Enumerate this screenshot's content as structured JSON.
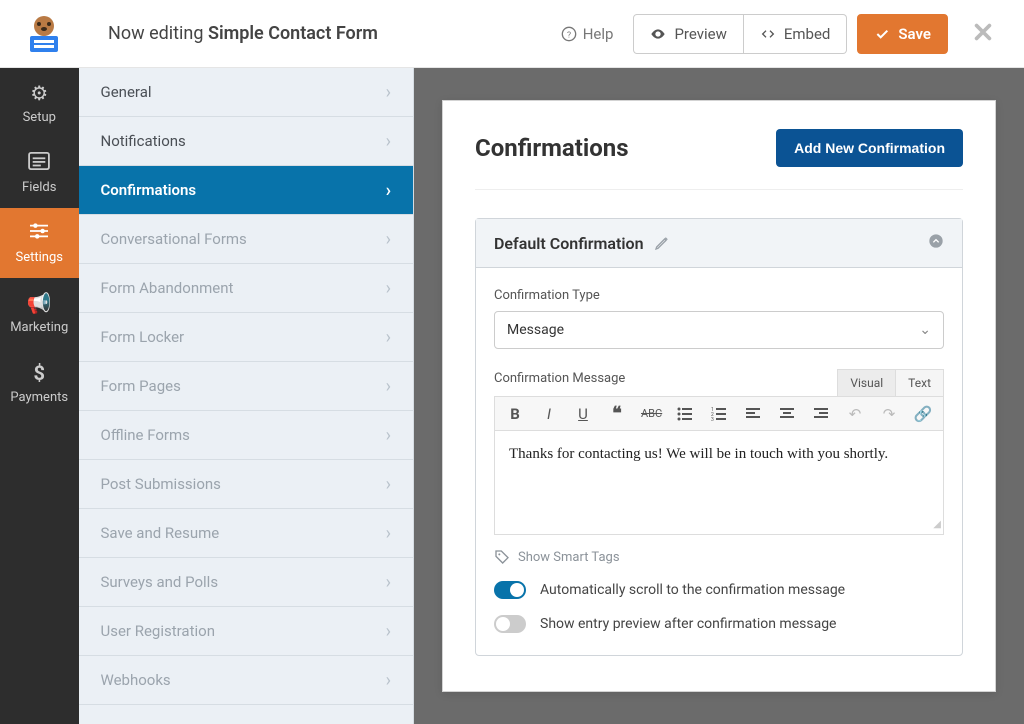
{
  "topbar": {
    "editing_prefix": "Now editing ",
    "form_name": "Simple Contact Form",
    "help": "Help",
    "preview": "Preview",
    "embed": "Embed",
    "save": "Save"
  },
  "leftnav": [
    {
      "label": "Setup",
      "icon": "gear"
    },
    {
      "label": "Fields",
      "icon": "list"
    },
    {
      "label": "Settings",
      "icon": "sliders",
      "active": true
    },
    {
      "label": "Marketing",
      "icon": "bullhorn"
    },
    {
      "label": "Payments",
      "icon": "dollar"
    }
  ],
  "sidebar": [
    {
      "label": "General"
    },
    {
      "label": "Notifications"
    },
    {
      "label": "Confirmations",
      "active": true
    },
    {
      "label": "Conversational Forms",
      "muted": true
    },
    {
      "label": "Form Abandonment",
      "muted": true
    },
    {
      "label": "Form Locker",
      "muted": true
    },
    {
      "label": "Form Pages",
      "muted": true
    },
    {
      "label": "Offline Forms",
      "muted": true
    },
    {
      "label": "Post Submissions",
      "muted": true
    },
    {
      "label": "Save and Resume",
      "muted": true
    },
    {
      "label": "Surveys and Polls",
      "muted": true
    },
    {
      "label": "User Registration",
      "muted": true
    },
    {
      "label": "Webhooks",
      "muted": true
    }
  ],
  "panel": {
    "title": "Confirmations",
    "add_button": "Add New Confirmation"
  },
  "card": {
    "title": "Default Confirmation",
    "fields": {
      "type_label": "Confirmation Type",
      "type_value": "Message",
      "message_label": "Confirmation Message",
      "tabs": {
        "visual": "Visual",
        "text": "Text"
      },
      "message_value": "Thanks for contacting us! We will be in touch with you shortly."
    },
    "smart_tags": "Show Smart Tags",
    "toggle1": {
      "label": "Automatically scroll to the confirmation message",
      "on": true
    },
    "toggle2": {
      "label": "Show entry preview after confirmation message",
      "on": false
    }
  }
}
